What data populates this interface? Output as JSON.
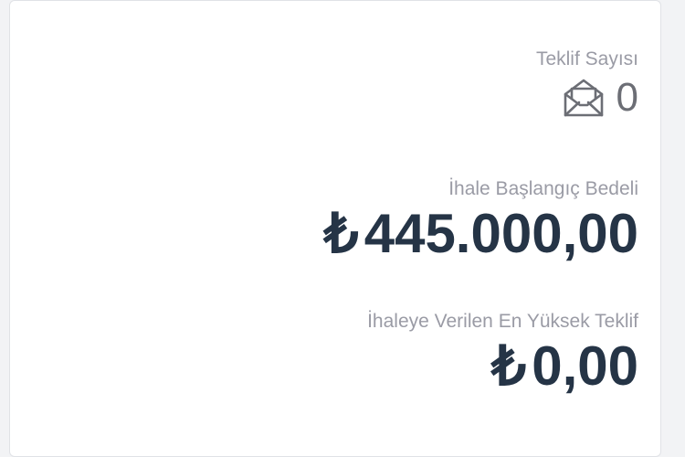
{
  "offers": {
    "label": "Teklif Sayısı",
    "icon": "open-envelope-icon",
    "count": "0"
  },
  "start_price": {
    "label": "İhale Başlangıç Bedeli",
    "currency": "₺",
    "amount": "445.000,00"
  },
  "highest_bid": {
    "label": "İhaleye Verilen En Yüksek Teklif",
    "currency": "₺",
    "amount": "0,00"
  },
  "colors": {
    "label": "#9a9ba5",
    "count": "#6c6e75",
    "amount": "#253446"
  }
}
